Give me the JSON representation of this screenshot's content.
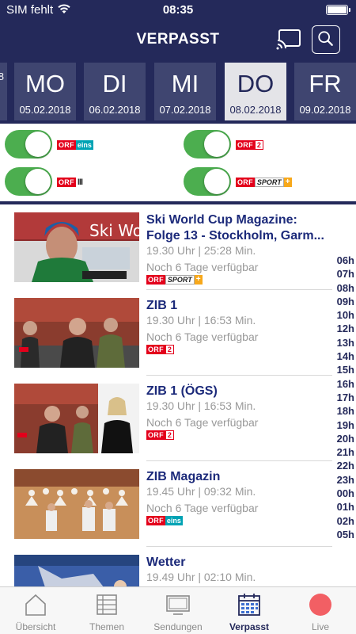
{
  "status": {
    "carrier": "SIM fehlt",
    "time": "08:35"
  },
  "header": {
    "title": "VERPASST"
  },
  "dates": [
    {
      "dow": "",
      "date": "8"
    },
    {
      "dow": "MO",
      "date": "05.02.2018"
    },
    {
      "dow": "DI",
      "date": "06.02.2018"
    },
    {
      "dow": "MI",
      "date": "07.02.2018"
    },
    {
      "dow": "DO",
      "date": "08.02.2018",
      "active": true
    },
    {
      "dow": "FR",
      "date": "09.02.2018"
    }
  ],
  "channels": {
    "orf1": {
      "orf": "ORF",
      "suffix": "eins",
      "enabled": true
    },
    "orf2": {
      "orf": "ORF",
      "suffix": "2",
      "enabled": true
    },
    "orf3": {
      "orf": "ORF",
      "suffix": "III",
      "enabled": true
    },
    "orfsport": {
      "orf": "ORF",
      "suffix": "SPORT",
      "plus": "+",
      "enabled": true
    }
  },
  "programs": [
    {
      "title": "Ski World Cup Magazine: Folge 13 - Stockholm, Garm...",
      "meta": "19.30 Uhr | 25:28 Min.",
      "avail": "Noch 6 Tage verfügbar",
      "channel": "orfsport"
    },
    {
      "title": "ZIB 1",
      "meta": "19.30 Uhr | 16:53 Min.",
      "avail": "Noch 6 Tage verfügbar",
      "channel": "orf2"
    },
    {
      "title": "ZIB 1 (ÖGS)",
      "meta": "19.30 Uhr | 16:53 Min.",
      "avail": "Noch 6 Tage verfügbar",
      "channel": "orf2"
    },
    {
      "title": "ZIB Magazin",
      "meta": "19.45 Uhr | 09:32 Min.",
      "avail": "Noch 6 Tage verfügbar",
      "channel": "orf1"
    },
    {
      "title": "Wetter",
      "meta": "19.49 Uhr | 02:10 Min.",
      "avail": "",
      "channel": "orf2"
    }
  ],
  "hours": [
    "06h",
    "07h",
    "08h",
    "09h",
    "10h",
    "12h",
    "13h",
    "14h",
    "15h",
    "16h",
    "17h",
    "18h",
    "19h",
    "20h",
    "21h",
    "22h",
    "23h",
    "00h",
    "01h",
    "02h",
    "05h"
  ],
  "tabs": [
    {
      "label": "Übersicht",
      "icon": "home-icon"
    },
    {
      "label": "Themen",
      "icon": "list-icon"
    },
    {
      "label": "Sendungen",
      "icon": "tv-icon"
    },
    {
      "label": "Verpasst",
      "icon": "calendar-icon",
      "active": true
    },
    {
      "label": "Live",
      "icon": "live-dot-icon"
    }
  ],
  "colors": {
    "brand": "#24295a",
    "toggle_on": "#4cae4f",
    "orf_red": "#e3001b",
    "live_red": "#f25f64"
  }
}
